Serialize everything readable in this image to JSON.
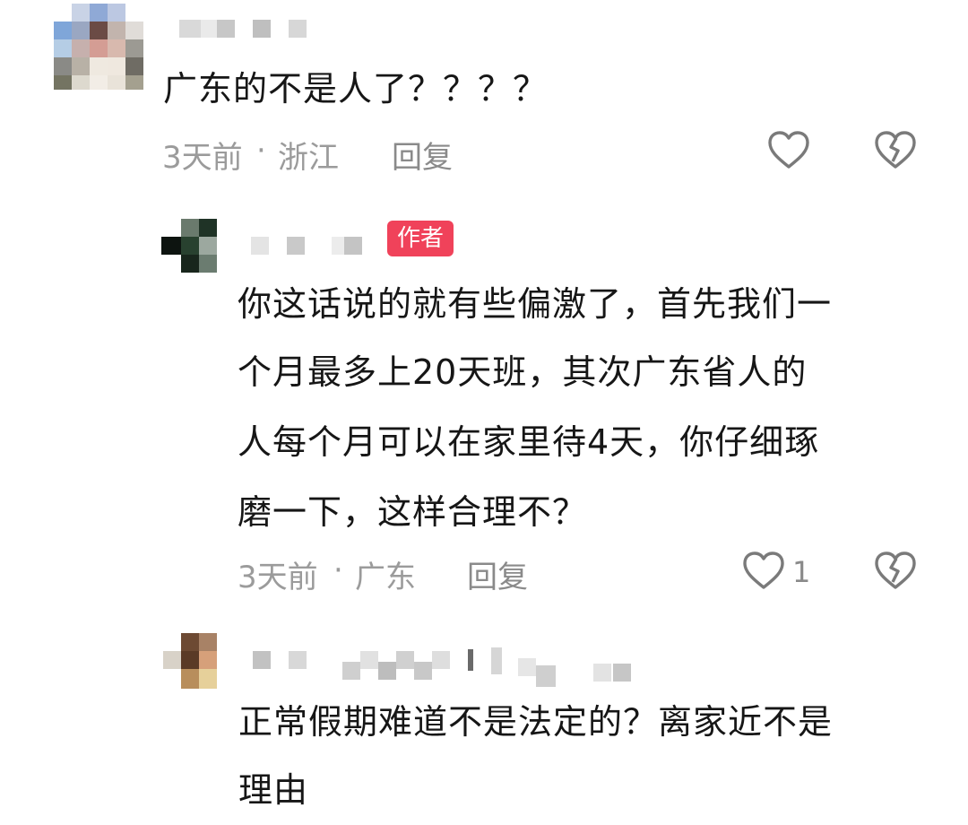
{
  "comments": [
    {
      "text": "广东的不是人了？？？？",
      "time": "3天前",
      "location": "浙江",
      "reply_label": "回复",
      "like_icon": "heart-icon",
      "dislike_icon": "broken-heart-icon"
    },
    {
      "badge": "作者",
      "lines": [
        "你这话说的就有些偏激了，首先我们一",
        "个月最多上20天班，其次广东省人的",
        "人每个月可以在家里待4天，你仔细琢",
        "磨一下，这样合理不？"
      ],
      "time": "3天前",
      "location": "广东",
      "reply_label": "回复",
      "likes": "1",
      "like_icon": "heart-icon",
      "dislike_icon": "broken-heart-icon"
    },
    {
      "lines": [
        "正常假期难道不是法定的？离家近不是",
        "理由"
      ]
    }
  ],
  "colors": {
    "badge": "#f0425a",
    "meta": "#9b9b9b",
    "text": "#161616"
  }
}
